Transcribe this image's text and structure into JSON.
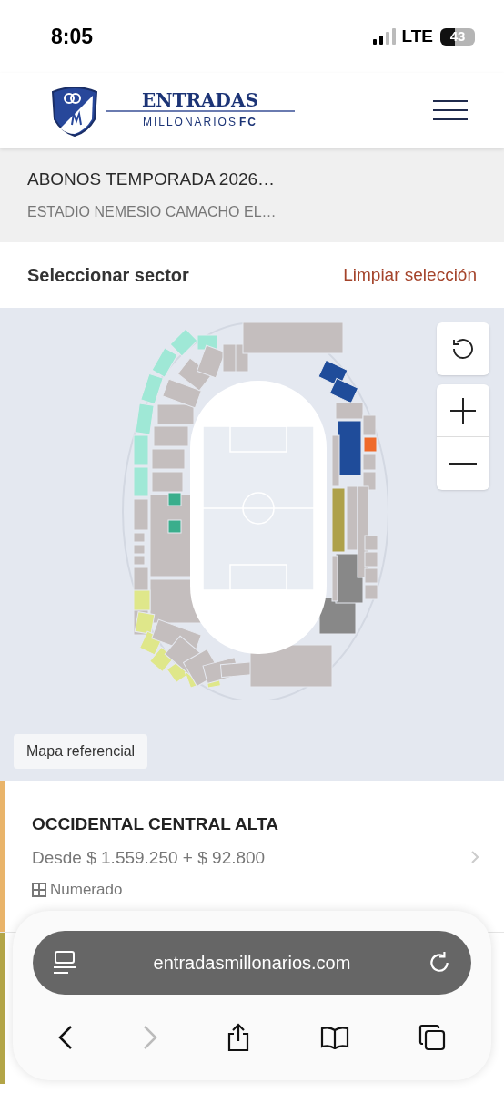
{
  "status_bar": {
    "time": "8:05",
    "network": "LTE",
    "battery": "43"
  },
  "header": {
    "brand_top": "ENTRADAS",
    "brand_bottom": "MILLONARIOS",
    "brand_suffix": "FC"
  },
  "event": {
    "title": "ABONOS TEMPORADA 2026…",
    "venue": "ESTADIO NEMESIO CAMACHO EL…"
  },
  "sector_bar": {
    "title": "Seleccionar sector",
    "clear": "Limpiar selección"
  },
  "map": {
    "label": "Mapa referencial"
  },
  "sectors": [
    {
      "name": "OCCIDENTAL CENTRAL ALTA",
      "price": "Desde $ 1.559.250 + $ 92.800",
      "seating": "Numerado",
      "color": "#e9b46a"
    },
    {
      "color": "#b3a547"
    }
  ],
  "browser": {
    "url": "entradasmillonarios.com",
    "forward_disabled": true
  }
}
